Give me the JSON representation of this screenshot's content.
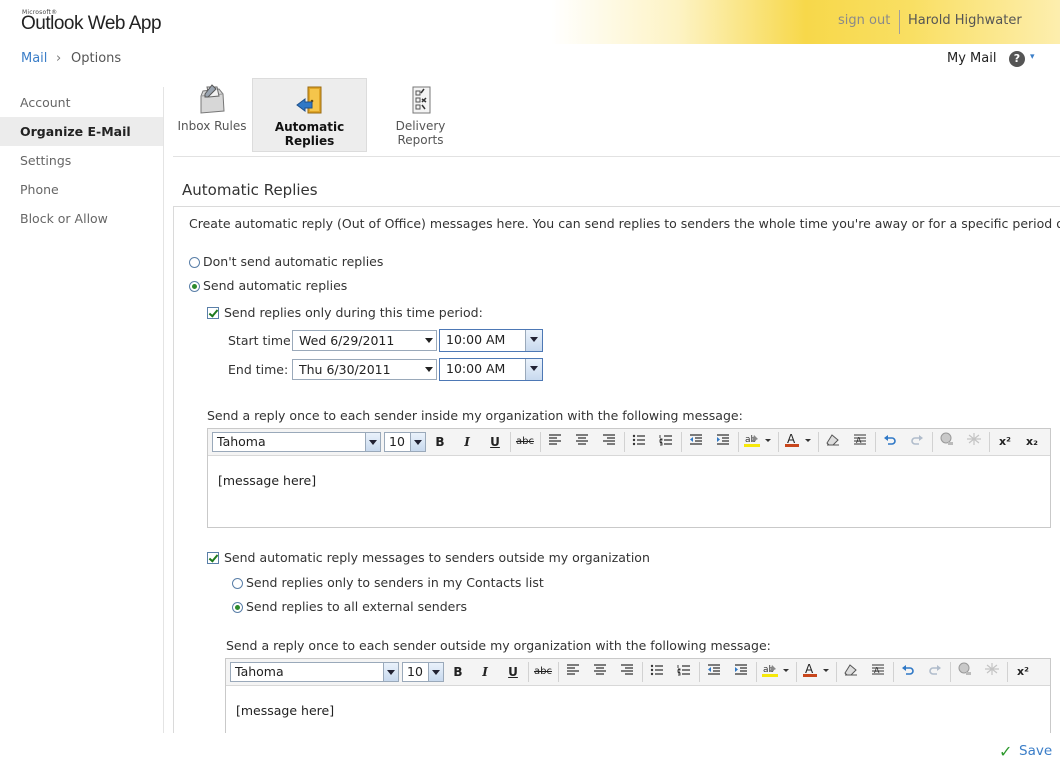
{
  "header": {
    "brand_small": "Microsoft®",
    "brand": "Outlook Web App",
    "sign_out": "sign out",
    "user_name": "Harold Highwater"
  },
  "breadcrumb": {
    "mail": "Mail",
    "separator": "›",
    "options": "Options"
  },
  "topright": {
    "my_mail": "My Mail",
    "help": "?",
    "help_caret": "▾"
  },
  "nav": {
    "items": [
      {
        "label": "Account",
        "active": false
      },
      {
        "label": "Organize E-Mail",
        "active": true
      },
      {
        "label": "Settings",
        "active": false
      },
      {
        "label": "Phone",
        "active": false
      },
      {
        "label": "Block or Allow",
        "active": false
      }
    ]
  },
  "tabs": [
    {
      "label": "Inbox Rules",
      "icon": "inbox-rules-icon"
    },
    {
      "label": "Automatic Replies",
      "icon": "automatic-replies-icon",
      "active": true
    },
    {
      "label": "Delivery Reports",
      "icon": "delivery-reports-icon"
    }
  ],
  "section_title": "Automatic Replies",
  "intro": "Create automatic reply (Out of Office) messages here. You can send replies to senders the whole time you're away or for a specific period of time.",
  "options": {
    "dont_send": "Don't send automatic replies",
    "send": "Send automatic replies",
    "time_period": "Send replies only during this time period:",
    "start_label": "Start time:",
    "end_label": "End time:",
    "start_date": "Wed 6/29/2011",
    "start_time": "10:00 AM",
    "end_date": "Thu 6/30/2011",
    "end_time": "10:00 AM",
    "inside_msg_label": "Send a reply once to each sender inside my organization with the following message:",
    "outside_checkbox": "Send automatic reply messages to senders outside my organization",
    "contacts_only": "Send replies only to senders in my Contacts list",
    "all_external": "Send replies to all external senders",
    "outside_msg_label": "Send a reply once to each sender outside my organization with the following message:"
  },
  "editor": {
    "font": "Tahoma",
    "size": "10",
    "bold": "B",
    "italic": "I",
    "underline": "U",
    "strike": "abc",
    "superscript": "x²",
    "subscript": "x₂",
    "inside_body": "[message here]",
    "outside_body": "[message here]"
  },
  "footer": {
    "save": "Save",
    "save_check": "✓"
  },
  "colors": {
    "accent": "#3b7ec8",
    "header_yellow": "#f7d84a",
    "check_green": "#2e9a2e"
  }
}
